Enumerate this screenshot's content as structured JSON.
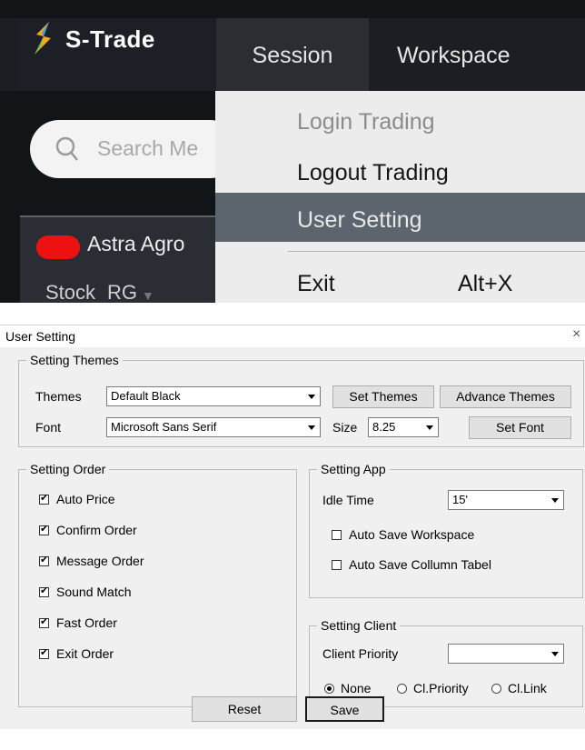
{
  "app": {
    "brand": "S-Trade",
    "menu": [
      "Session",
      "Workspace"
    ],
    "search_placeholder": "Search Me",
    "panel_title": "Astra Agro",
    "stock_label": "Stock",
    "stock_value": "RG",
    "dropdown": {
      "items": [
        "Login Trading",
        "Logout Trading",
        "User Setting",
        "Exit"
      ],
      "exit_shortcut": "Alt+X",
      "disabled_item": "Login Trading",
      "highlighted_item": "User Setting"
    },
    "colors": {
      "dark_bg": "#111518",
      "highlight": "#5c646e",
      "status_red": "#ee1111"
    }
  },
  "dialog": {
    "title": "User Setting",
    "close": "×",
    "themes_group": {
      "legend": "Setting Themes",
      "themes_label": "Themes",
      "themes_value": "Default Black",
      "set_themes": "Set Themes",
      "advance_themes": "Advance Themes",
      "font_label": "Font",
      "font_value": "Microsoft Sans Serif",
      "size_label": "Size",
      "size_value": "8.25",
      "set_font": "Set Font"
    },
    "order_group": {
      "legend": "Setting Order",
      "items": [
        {
          "label": "Auto Price",
          "checked": true
        },
        {
          "label": "Confirm Order",
          "checked": true
        },
        {
          "label": "Message Order",
          "checked": true
        },
        {
          "label": "Sound Match",
          "checked": true
        },
        {
          "label": "Fast Order",
          "checked": true
        },
        {
          "label": "Exit Order",
          "checked": true
        }
      ]
    },
    "app_group": {
      "legend": "Setting App",
      "idle_label": "Idle Time",
      "idle_value": "15'",
      "auto_save_workspace": "Auto Save Workspace",
      "auto_save_column": "Auto Save Collumn Tabel"
    },
    "client_group": {
      "legend": "Setting Client",
      "priority_label": "Client Priority",
      "priority_value": "",
      "radios": [
        "None",
        "Cl.Priority",
        "Cl.Link"
      ],
      "selected": "None"
    },
    "reset": "Reset",
    "save": "Save"
  }
}
